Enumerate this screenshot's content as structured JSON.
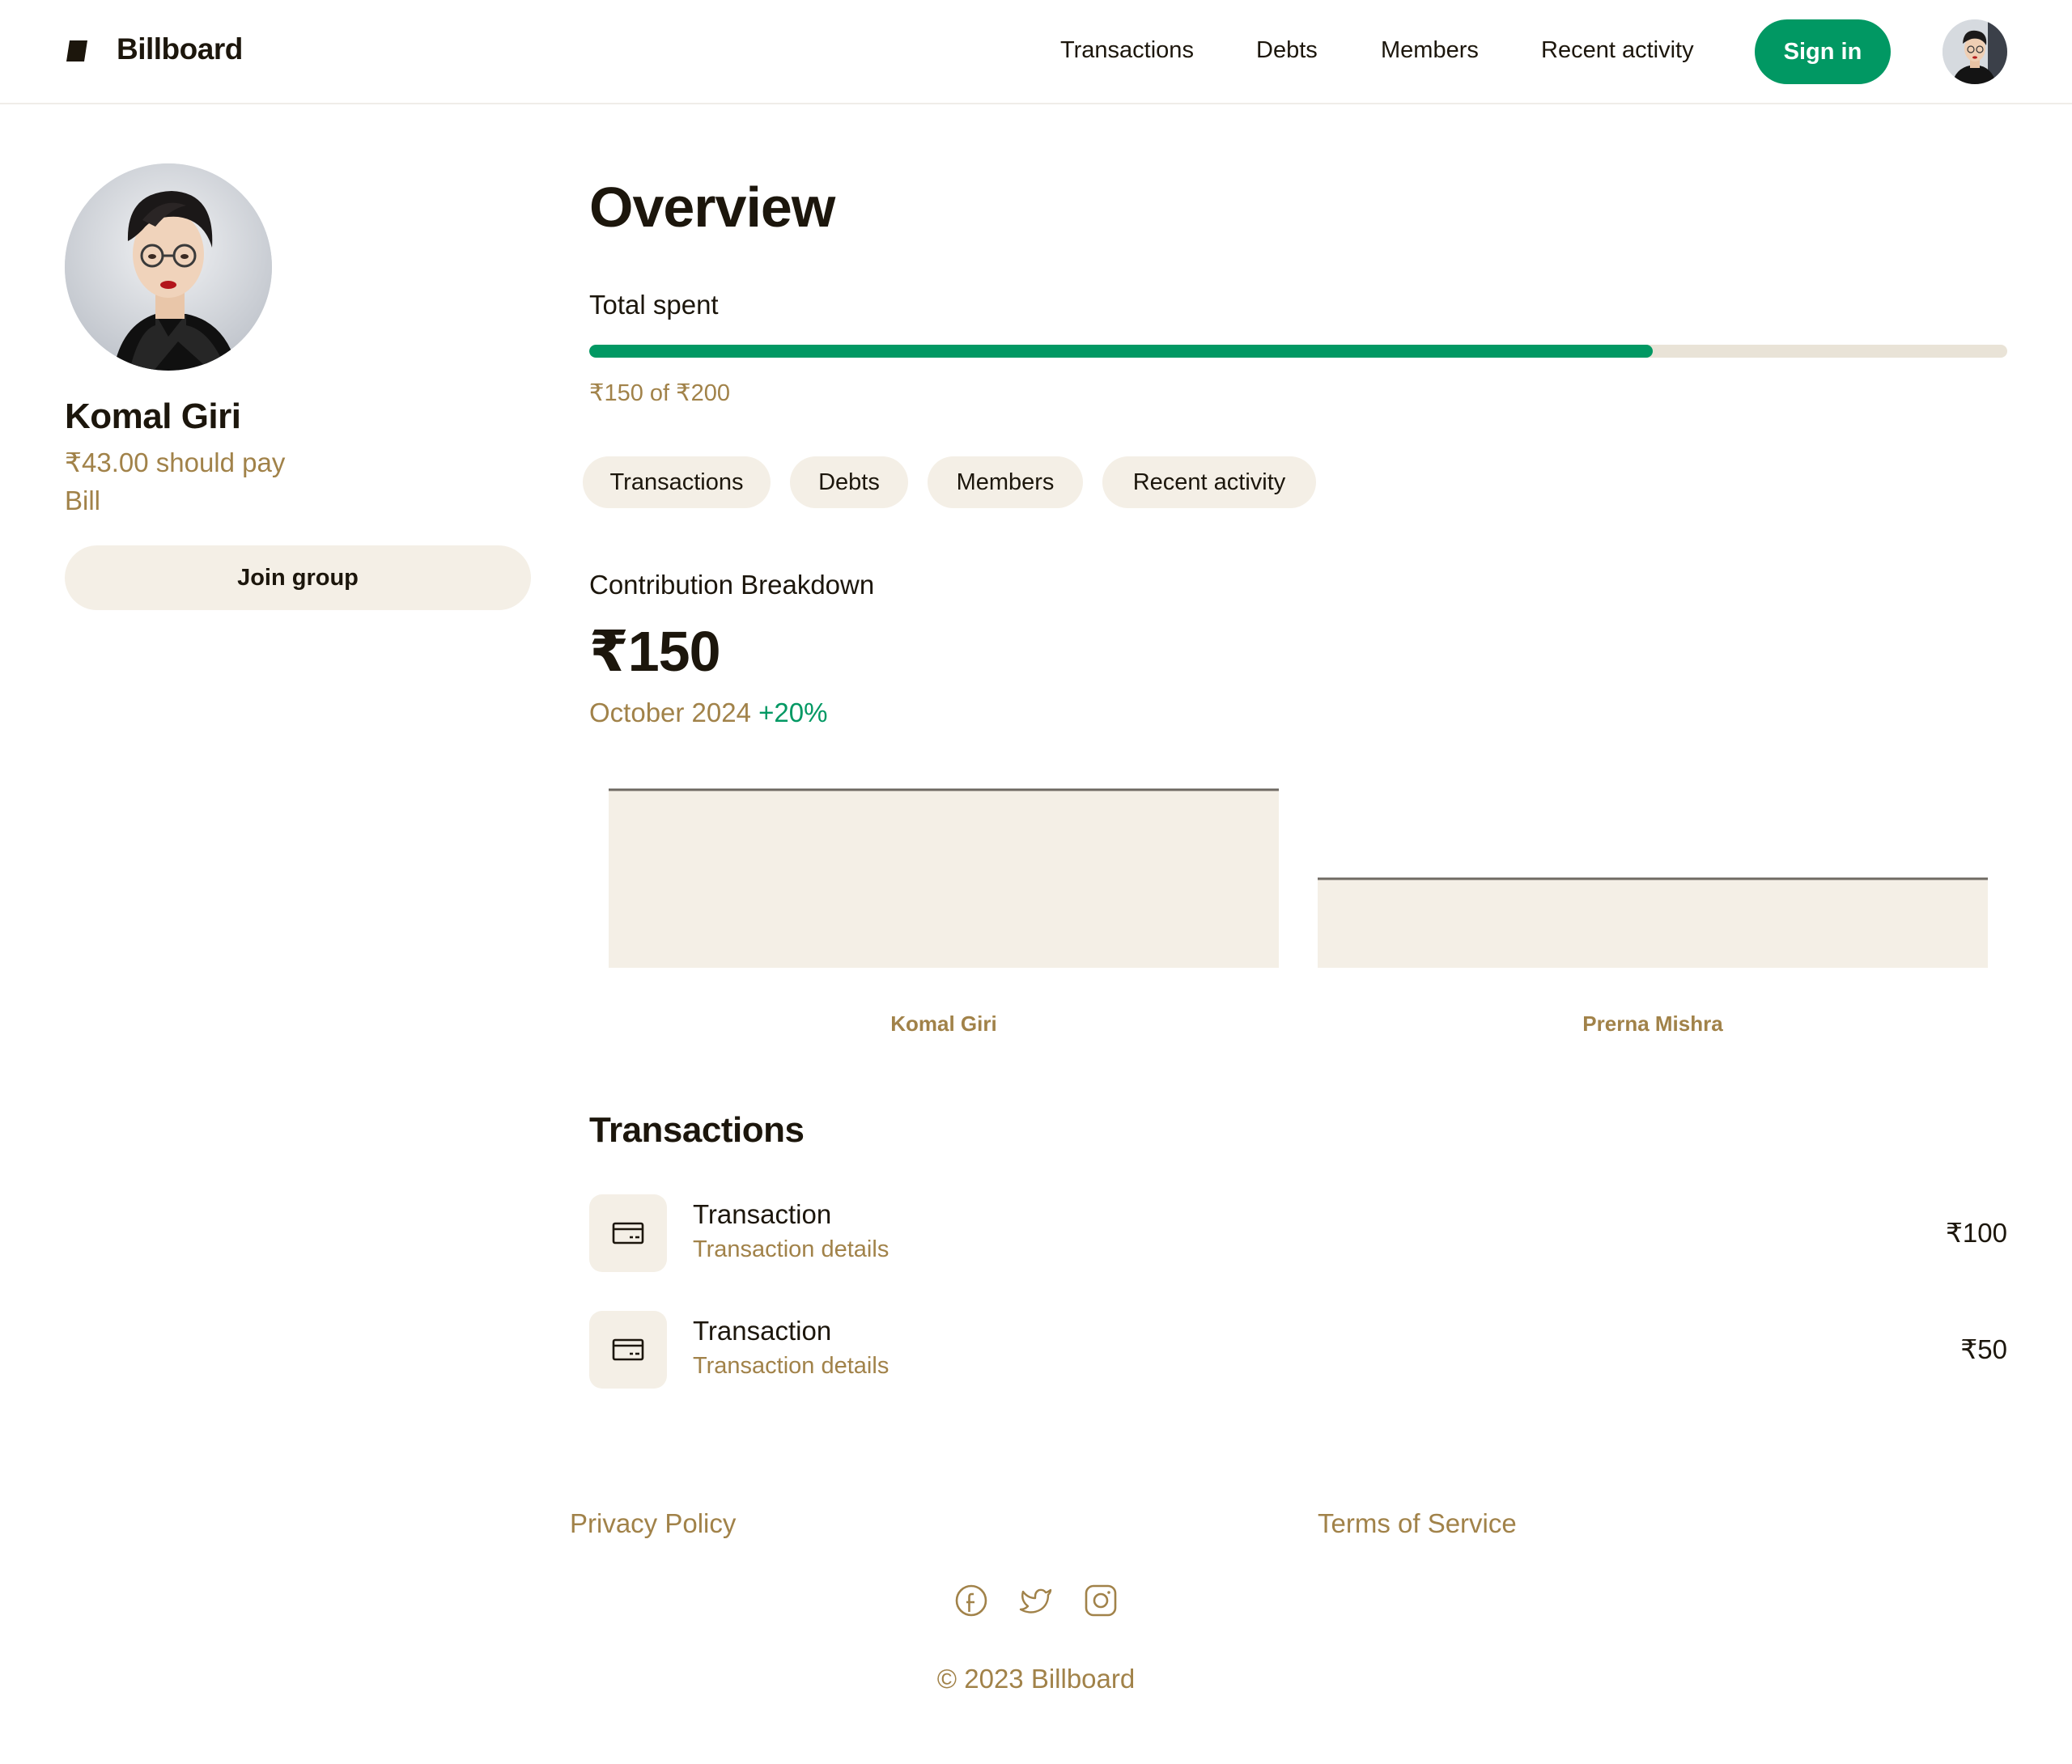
{
  "header": {
    "brand": "Billboard",
    "nav": [
      "Transactions",
      "Debts",
      "Members",
      "Recent activity"
    ],
    "signin_label": "Sign in"
  },
  "profile": {
    "name": "Komal Giri",
    "owe": "₹43.00 should pay",
    "type": "Bill",
    "join_label": "Join group"
  },
  "overview": {
    "title": "Overview",
    "progress_label": "Total spent",
    "progress_caption": "₹150 of ₹200",
    "progress_fraction": 0.75
  },
  "tabs": [
    "Transactions",
    "Debts",
    "Members",
    "Recent activity"
  ],
  "breakdown": {
    "label": "Contribution Breakdown",
    "amount": "₹150",
    "period": "October 2024",
    "delta": "+20%"
  },
  "chart_data": {
    "type": "bar",
    "categories": [
      "Komal Giri",
      "Prerna Mishra"
    ],
    "values": [
      100,
      50
    ],
    "title": "",
    "xlabel": "",
    "ylabel": "",
    "grid": false
  },
  "transactions": {
    "heading": "Transactions",
    "items": [
      {
        "title": "Transaction",
        "details": "Transaction details",
        "amount": "₹100"
      },
      {
        "title": "Transaction",
        "details": "Transaction details",
        "amount": "₹50"
      }
    ]
  },
  "footer": {
    "privacy": "Privacy Policy",
    "terms": "Terms of Service",
    "social_icons": [
      "facebook-icon",
      "twitter-icon",
      "instagram-icon"
    ],
    "copyright": "© 2023 Billboard"
  },
  "colors": {
    "accent": "#019863",
    "muted_text": "#a18249",
    "chip_bg": "#f4efe6",
    "text": "#1c160c"
  }
}
